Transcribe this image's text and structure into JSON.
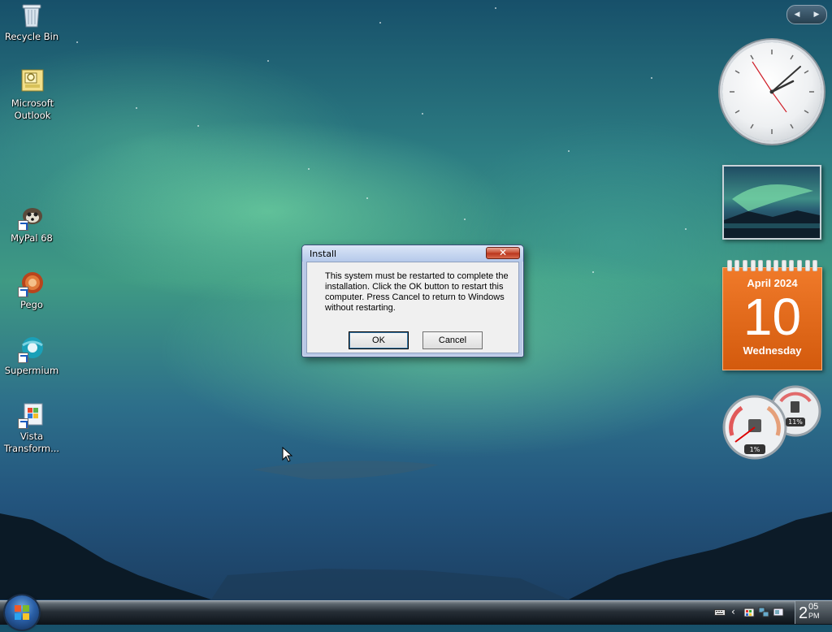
{
  "desktop_icons": {
    "recycle_bin": "Recycle Bin",
    "outlook": "Microsoft Outlook",
    "mypal": "MyPal 68",
    "pego": "Pego",
    "supermium": "Supermium",
    "vista_transform": "Vista Transform..."
  },
  "dialog": {
    "title": "Install",
    "message": "This system must be restarted to complete the installation. Click the OK button to restart this computer. Press Cancel to return to Windows without restarting.",
    "ok_label": "OK",
    "cancel_label": "Cancel",
    "close_glyph": "✕"
  },
  "sidebar": {
    "nav_prev": "◀",
    "nav_next": "▶",
    "calendar": {
      "month": "April 2024",
      "day": "10",
      "weekday": "Wednesday"
    },
    "meter": {
      "cpu": "1%",
      "ram": "11%"
    }
  },
  "taskbar": {
    "clock_hour": "2",
    "clock_minutes": "05",
    "clock_ampm": "PM"
  },
  "icons": [
    "recycle-bin-icon",
    "outlook-icon",
    "mypal-icon",
    "pego-icon",
    "supermium-icon",
    "vista-transform-icon",
    "start-orb-icon",
    "keyboard-icon",
    "network-icon",
    "volume-icon"
  ]
}
